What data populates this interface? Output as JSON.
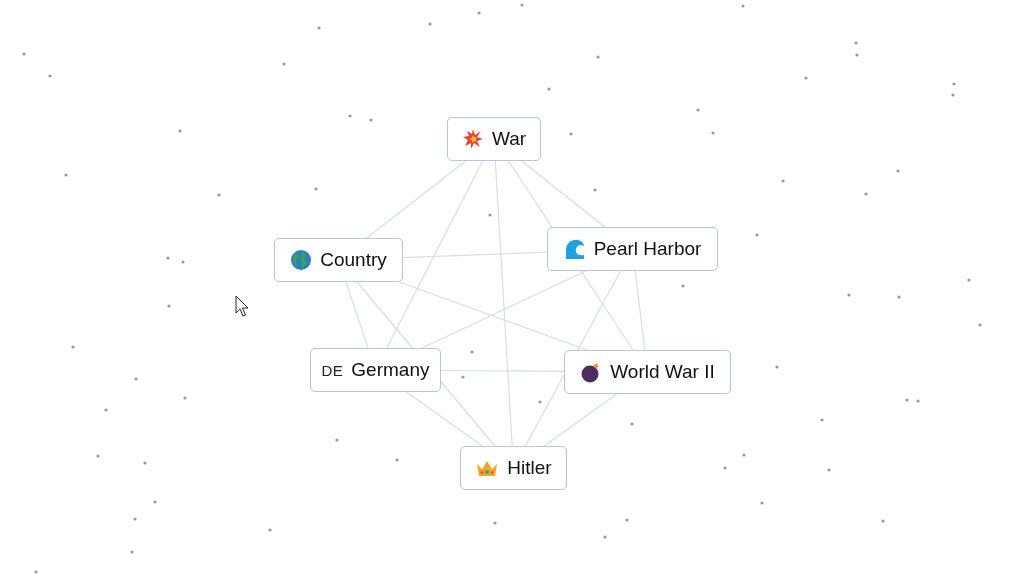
{
  "elements": [
    {
      "label": "War",
      "kind": "explosion"
    },
    {
      "label": "Country",
      "kind": "globe"
    },
    {
      "label": "Pearl Harbor",
      "kind": "wave"
    },
    {
      "label": "Germany",
      "kind": "letters",
      "icon_text": "DE"
    },
    {
      "label": "World War II",
      "kind": "bomb"
    },
    {
      "label": "Hitler",
      "kind": "crown"
    }
  ]
}
